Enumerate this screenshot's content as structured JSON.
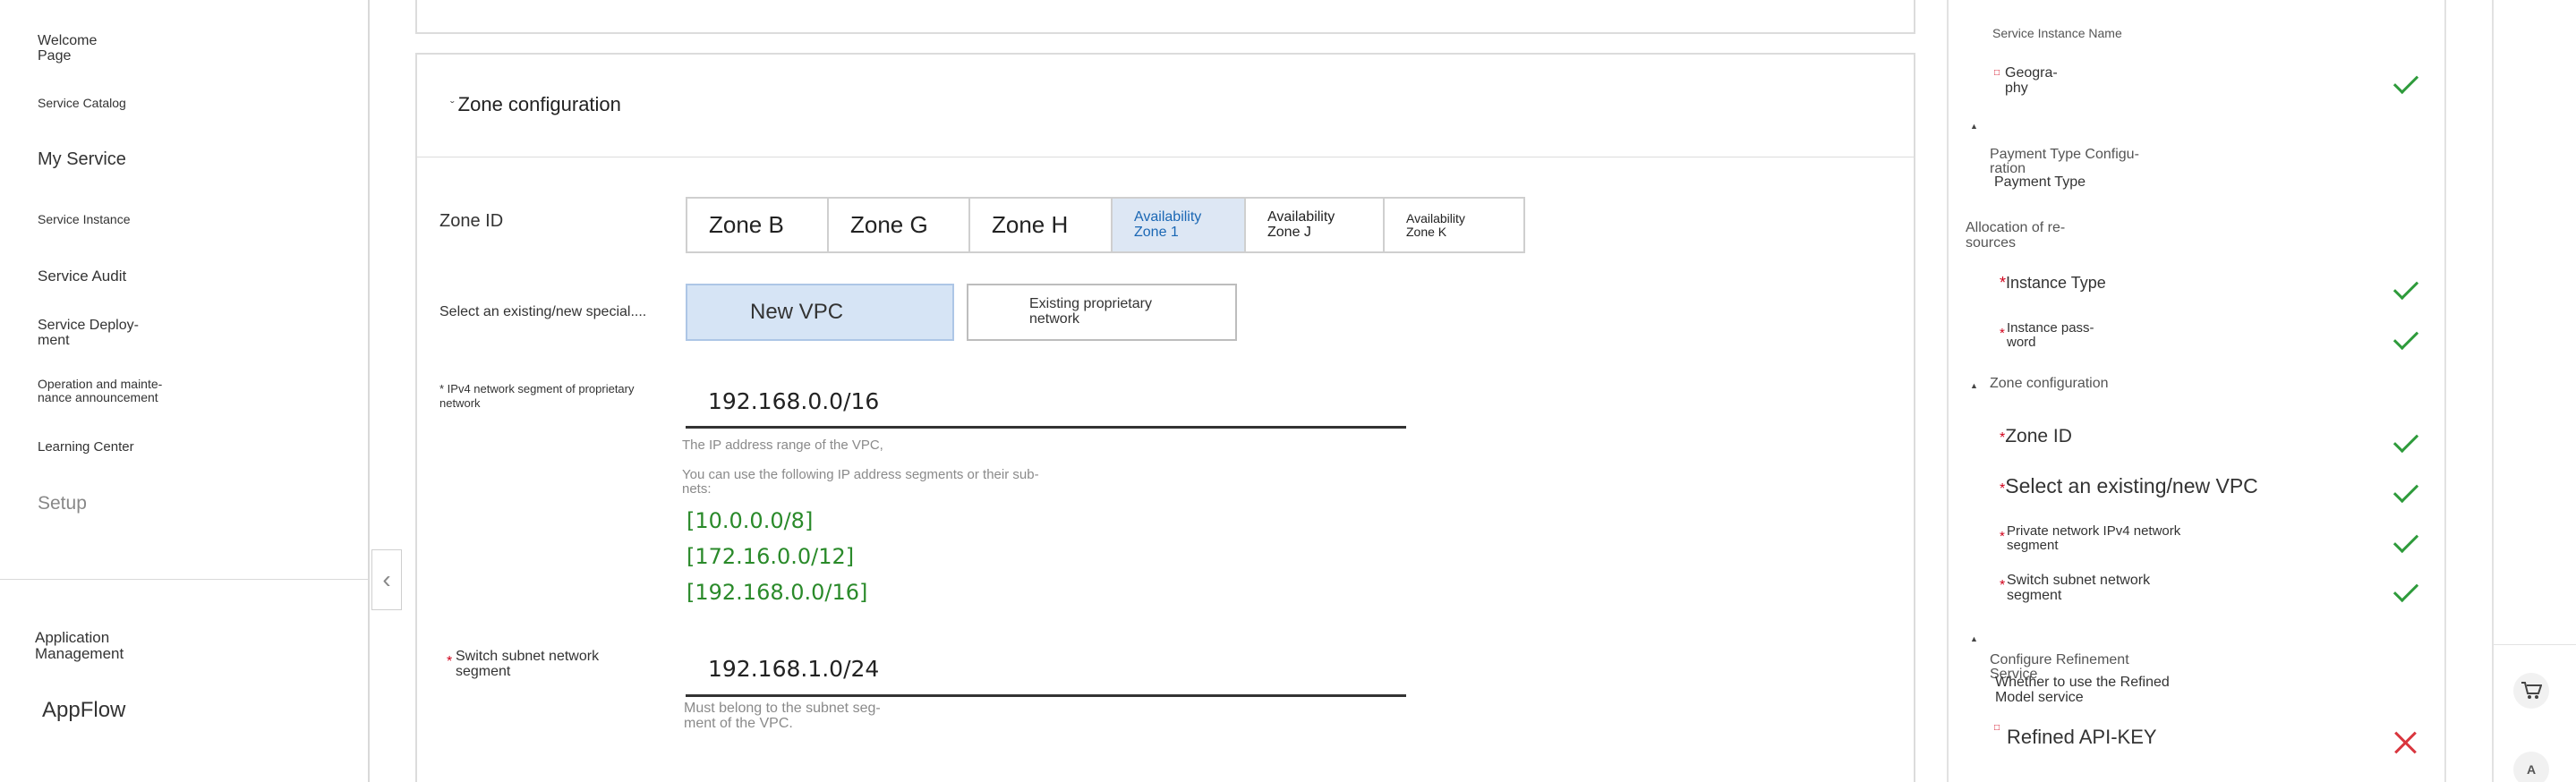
{
  "sidebar": {
    "items": [
      {
        "label": "Welcome\nPage"
      },
      {
        "label": "Service Catalog"
      },
      {
        "label": "My Service"
      },
      {
        "label": "Service Instance"
      },
      {
        "label": "Service Audit"
      },
      {
        "label": "Service Deploy-\nment"
      },
      {
        "label": "Operation and mainte-\nnance announcement"
      },
      {
        "label": "Learning Center"
      },
      {
        "label": "Setup"
      }
    ],
    "bottom": {
      "app_management": "Application\nManagement",
      "appflow": "AppFlow"
    },
    "collapse_icon": "chevron-left-icon"
  },
  "zone_card": {
    "title": "Zone configuration",
    "zone_id_label": "Zone ID",
    "zones": [
      {
        "label": "Zone B",
        "active": false
      },
      {
        "label": "Zone G",
        "active": false
      },
      {
        "label": "Zone H",
        "active": false
      },
      {
        "label": "Availability\nZone 1",
        "active": true
      },
      {
        "label": "Availability\nZone J",
        "active": false
      },
      {
        "label": "Availability\nZone K",
        "active": false
      }
    ],
    "vpc_label": "Select an existing/new special....",
    "vpc_new": "New VPC",
    "vpc_existing": "Existing proprietary\nnetwork",
    "ipv4_label": "* IPv4 network segment of proprietary\nnetwork",
    "ipv4_value": "192.168.0.0/16",
    "ipv4_hint1": "The IP address range of the VPC,",
    "ipv4_hint2": "You can use the following IP address segments or their sub-\nnets:",
    "cidrs": [
      "[10.0.0.0/8]",
      "[172.16.0.0/12]",
      "[192.168.0.0/16]"
    ],
    "switch_label": "Switch subnet network\nsegment",
    "switch_value": "192.168.1.0/24",
    "switch_hint": "Must belong to the subnet seg-\nment of the VPC."
  },
  "summary": {
    "service_instance_name": "Service Instance Name",
    "geography": "Geogra-\nphy",
    "payment_section": "Payment Type Configu-\nration",
    "payment_type": "Payment Type",
    "alloc_section": "Allocation of re-\nsources",
    "instance_type": "Instance Type",
    "instance_password": "Instance pass-\nword",
    "zone_section": "Zone configuration",
    "zone_id": "Zone ID",
    "select_vpc": "Select an existing/new VPC",
    "private_segment": "Private network IPv4 network\nsegment",
    "switch_segment": "Switch subnet network\nsegment",
    "refine_section": "Configure Refinement\nService",
    "refine_q": "Whether to use the Refined\nModel service",
    "refine_key": "Refined API-KEY"
  },
  "colors": {
    "accent_blue": "#1a67b4",
    "selected_bg": "#d6e4f5",
    "ok_green": "#2e9b3b",
    "error_red": "#d9363e",
    "cidr_green": "#2a8a2a"
  }
}
